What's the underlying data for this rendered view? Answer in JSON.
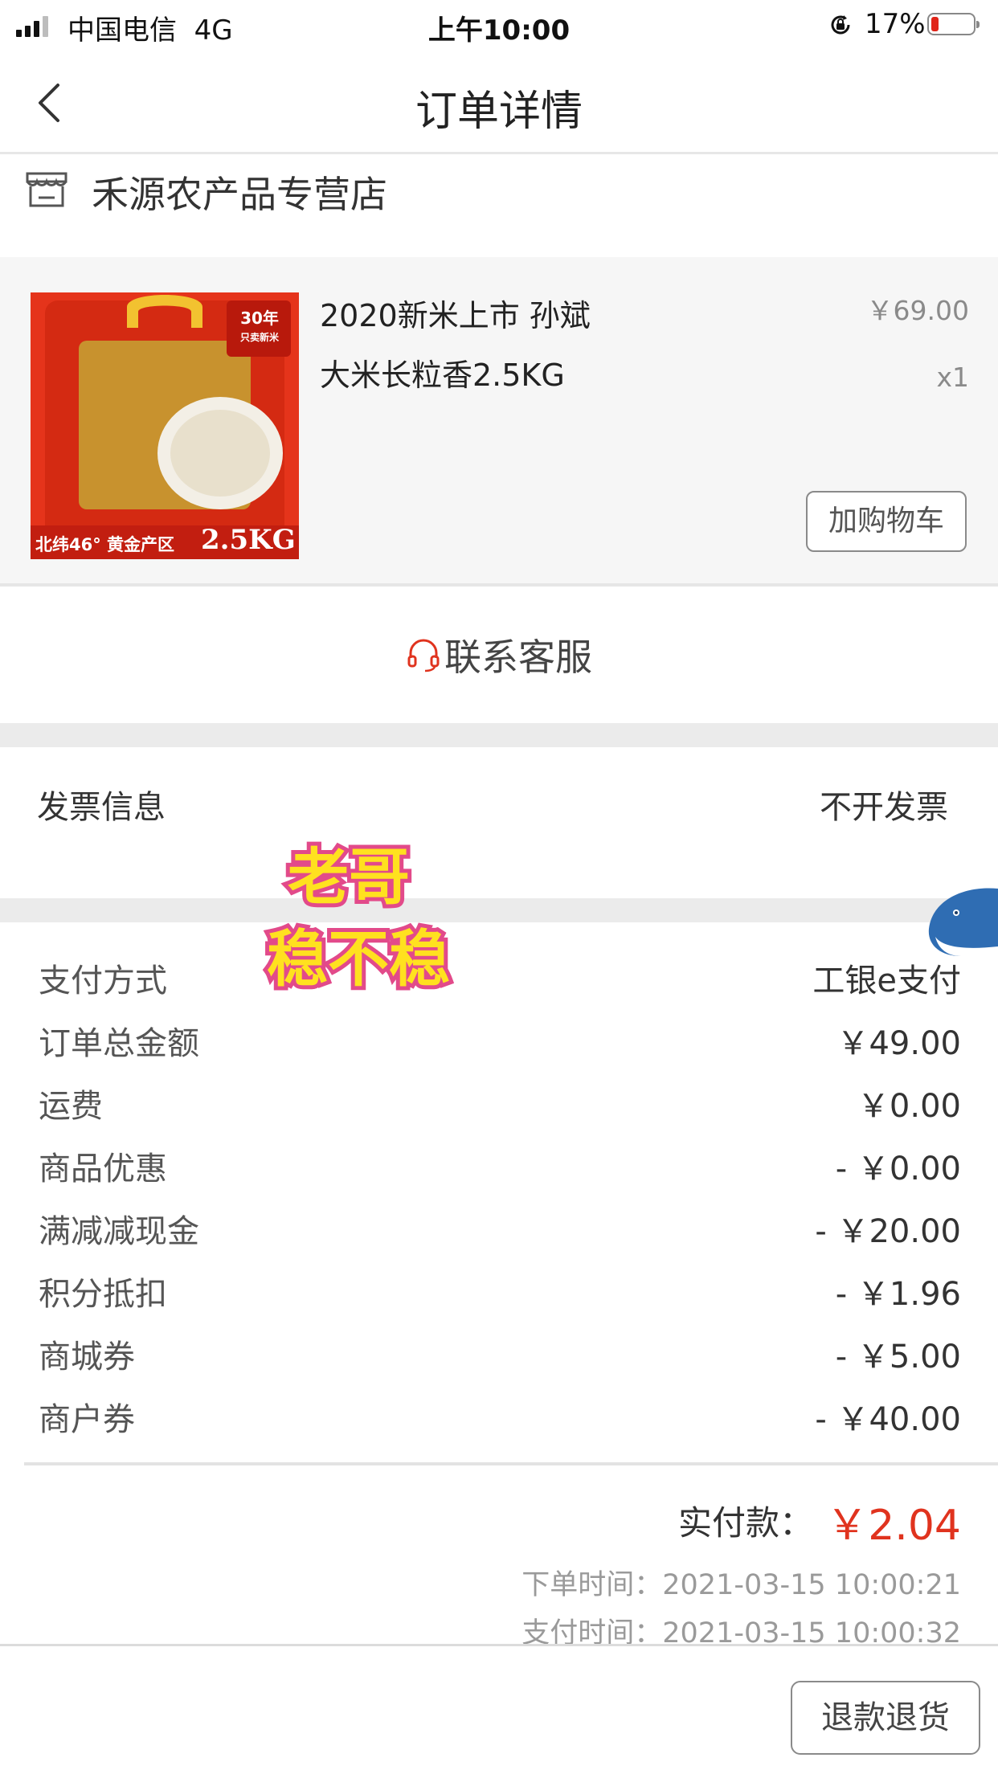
{
  "status_bar": {
    "carrier": "中国电信",
    "network": "4G",
    "time": "上午10:00",
    "battery_pct": "17%"
  },
  "nav": {
    "title": "订单详情",
    "back_icon": "chevron-left-icon"
  },
  "store": {
    "name": "禾源农产品专营店",
    "icon": "store-icon"
  },
  "product": {
    "title_line1": "2020新米上市 孙斌",
    "title_line2": "大米长粒香2.5KG",
    "price": "￥69.00",
    "qty": "x1",
    "add_to_cart": "加购物车",
    "thumb_badge": "30年",
    "thumb_sub": "只卖新米",
    "thumb_banner": "北纬46° 黄金产区",
    "thumb_weight": "2.5KG"
  },
  "service": {
    "label": "联系客服",
    "icon": "headset-icon"
  },
  "invoice": {
    "label": "发票信息",
    "value": "不开发票"
  },
  "payment": {
    "rows": [
      {
        "label": "支付方式",
        "value": "工银e支付"
      },
      {
        "label": "订单总金额",
        "value": "￥49.00"
      },
      {
        "label": "运费",
        "value": "￥0.00"
      },
      {
        "label": "商品优惠",
        "value": "- ￥0.00"
      },
      {
        "label": "满减减现金",
        "value": "- ￥20.00"
      },
      {
        "label": "积分抵扣",
        "value": "- ￥1.96"
      },
      {
        "label": "商城券",
        "value": "- ￥5.00"
      },
      {
        "label": "商户券",
        "value": "- ￥40.00"
      }
    ],
    "paid_label": "实付款：",
    "paid_value": "￥2.04",
    "order_time": "下单时间：2021-03-15 10:00:21",
    "pay_time": "支付时间：2021-03-15 10:00:32"
  },
  "actions": {
    "refund": "退款退货"
  },
  "overlay": {
    "sticker_line1": "老哥",
    "sticker_line2": "稳不稳"
  },
  "colors": {
    "accent_red": "#e0331e",
    "section_gap": "#ebebeb"
  }
}
